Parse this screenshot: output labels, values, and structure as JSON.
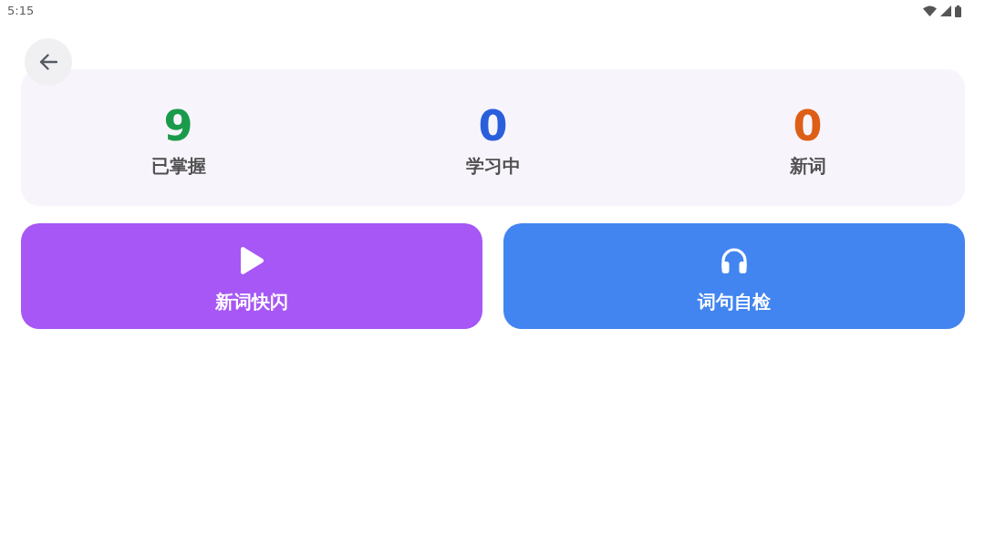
{
  "status_bar": {
    "time": "5:15"
  },
  "stats": [
    {
      "value": "9",
      "label": "已掌握",
      "color": "#1a9b4b"
    },
    {
      "value": "0",
      "label": "学习中",
      "color": "#2a5fdc"
    },
    {
      "value": "0",
      "label": "新词",
      "color": "#dd5f17"
    }
  ],
  "actions": [
    {
      "label": "新词快闪",
      "kind": "play",
      "color": "#a757f5"
    },
    {
      "label": "词句自检",
      "kind": "listen",
      "color": "#4285f0"
    }
  ]
}
